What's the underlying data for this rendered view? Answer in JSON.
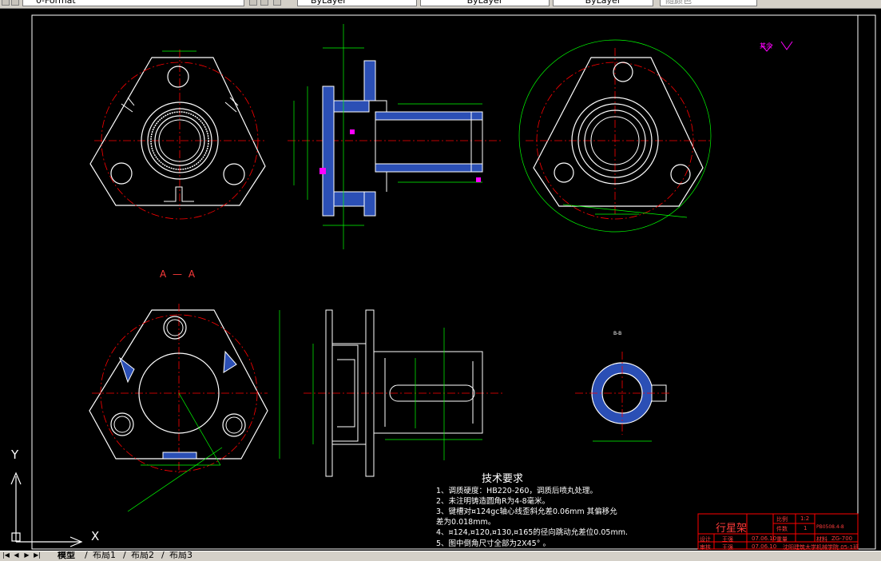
{
  "toolbar": {
    "layer_field": "0-Format",
    "color_field": "ByLayer",
    "linetype_field": "ByLayer",
    "lineweight_field": "ByLayer",
    "plotstyle_field": "随颜色"
  },
  "drawing": {
    "section_label": "A — A",
    "section_label_small": "B-B",
    "roughness_note": "其余",
    "tech_title": "技术要求",
    "tech_items": [
      "1、调质硬度：HB220-260，调质后喷丸处理。",
      "2、未注明铸造圆角R为4-8毫米。",
      "3、键槽对¤124gc轴心线歪斜允差0.06mm 其偏移允",
      "   差为0.018mm。",
      "4、¤124,¤120,¤130,¤165的径向跳动允差位0.05mm.",
      "5、图中倒角尺寸全部为2X45°  。"
    ],
    "title_block": {
      "part_name": "行星架",
      "scale_label": "比例",
      "scale_value": "1:2",
      "qty_label": "件数",
      "qty_value": "1",
      "weight_label": "重量",
      "drawing_no": "PB0508.4-8",
      "material_label": "材料",
      "material_value": "ZG-700",
      "design_label": "设计",
      "design_name": "王强",
      "design_date": "07.06.10",
      "check_label": "审核",
      "check_name": "王强",
      "check_date": "07.06.10",
      "school": "沈阳建筑大学机械学院 05-1班"
    }
  },
  "ucs": {
    "x_label": "X",
    "y_label": "Y"
  },
  "layout_tabs": [
    "模型",
    "布局1",
    "布局2",
    "布局3"
  ],
  "colors": {
    "background": "#000000",
    "outline": "#ffffff",
    "centerline": "#ff0000",
    "dimension": "#00ff00",
    "hatch": "#4a6fd6",
    "roughness": "#ff00ff",
    "title_block": "#ff0000"
  }
}
